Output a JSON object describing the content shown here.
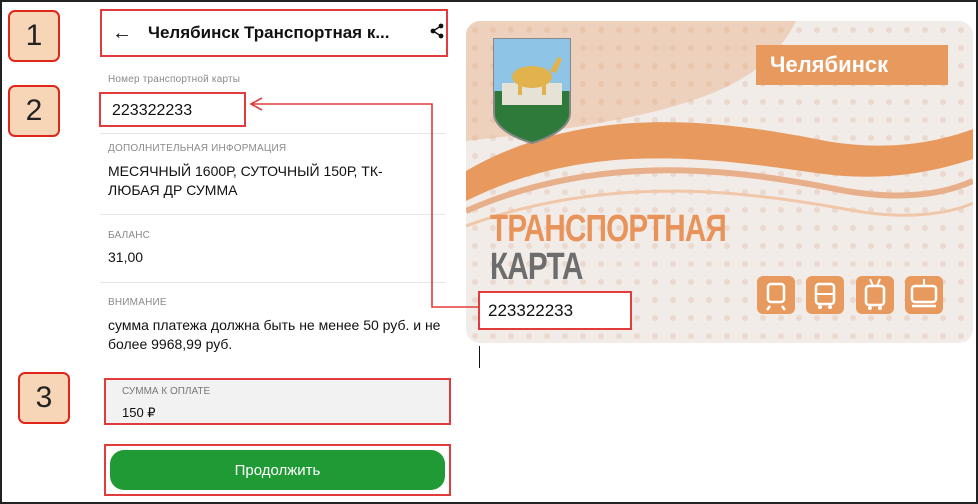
{
  "steps": [
    "1",
    "2",
    "3"
  ],
  "header": {
    "title": "Челябинск Транспортная к...",
    "back_icon": "arrow-left-icon",
    "share_icon": "share-icon"
  },
  "fields": {
    "card_number_label": "Номер транспортной карты",
    "card_number": "223322233",
    "info_label": "ДОПОЛНИТЕЛЬНАЯ ИНФОРМАЦИЯ",
    "info_value": "МЕСЯЧНЫЙ 1600Р, СУТОЧНЫЙ 150Р, ТК-ЛЮБАЯ ДР СУММА",
    "balance_label": "БАЛАНС",
    "balance_value": "31,00",
    "attention_label": "ВНИМАНИЕ",
    "attention_value": "сумма платежа должна быть не менее 50 руб. и не более 9968,99 руб."
  },
  "payment": {
    "label": "СУММА К ОПЛАТЕ",
    "value": "150 ₽"
  },
  "button": {
    "label": "Продолжить"
  },
  "card": {
    "city": "Челябинск",
    "title_line1": "ТРАНСПОРТНАЯ",
    "title_line2": "КАРТА",
    "number": "223322233",
    "transport_icons": [
      "train-icon",
      "bus-icon",
      "trolleybus-icon",
      "tram-icon"
    ]
  },
  "colors": {
    "accent_red": "#e23b3b",
    "button_green": "#1f9a34",
    "card_orange": "#e89a5e"
  }
}
